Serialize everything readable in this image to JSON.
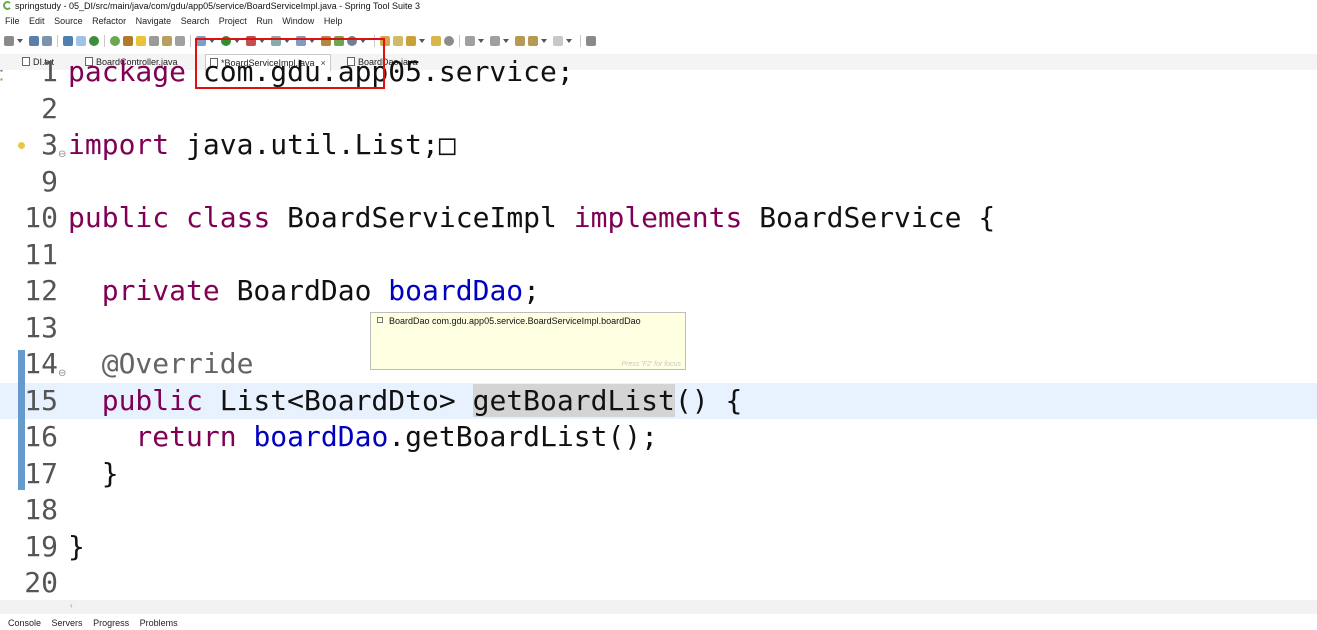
{
  "window": {
    "title": "springstudy - 05_DI/src/main/java/com/gdu/app05/service/BoardServiceImpl.java - Spring Tool Suite 3"
  },
  "menu": [
    "File",
    "Edit",
    "Source",
    "Refactor",
    "Navigate",
    "Search",
    "Project",
    "Run",
    "Window",
    "Help"
  ],
  "tabs": [
    {
      "label": "DI.txt"
    },
    {
      "label": "BoardController.java"
    },
    {
      "label": "*BoardServiceImpl.java",
      "close": "×"
    },
    {
      "label": "BoardDao.java"
    }
  ],
  "editor": {
    "lines": [
      {
        "num": "1",
        "parts": [
          {
            "t": "package ",
            "c": "kw"
          },
          {
            "t": "com.gdu.app05.service;"
          }
        ]
      },
      {
        "num": "2",
        "parts": []
      },
      {
        "num": "3",
        "parts": [
          {
            "t": "import ",
            "c": "kw"
          },
          {
            "t": "java.util.List;"
          },
          {
            "t": "□"
          }
        ]
      },
      {
        "num": "9",
        "parts": []
      },
      {
        "num": "10",
        "parts": [
          {
            "t": "public ",
            "c": "kw"
          },
          {
            "t": "class ",
            "c": "kw"
          },
          {
            "t": "BoardServiceImpl "
          },
          {
            "t": "implements ",
            "c": "kw"
          },
          {
            "t": "BoardService {"
          }
        ]
      },
      {
        "num": "11",
        "parts": []
      },
      {
        "num": "12",
        "parts": [
          {
            "t": "  private ",
            "c": "kw"
          },
          {
            "t": "BoardDao "
          },
          {
            "t": "boardDao",
            "c": "fld"
          },
          {
            "t": ";"
          }
        ]
      },
      {
        "num": "13",
        "parts": []
      },
      {
        "num": "14",
        "parts": [
          {
            "t": "  @Override",
            "c": "ann"
          }
        ]
      },
      {
        "num": "15",
        "parts": [
          {
            "t": "  public ",
            "c": "kw"
          },
          {
            "t": "List<BoardDto> "
          },
          {
            "t": "getBoardList",
            "c": "hl"
          },
          {
            "t": "() {"
          }
        ]
      },
      {
        "num": "16",
        "parts": [
          {
            "t": "    return ",
            "c": "kw"
          },
          {
            "t": "boardDao",
            "c": "fld"
          },
          {
            "t": ".getBoardList();"
          }
        ]
      },
      {
        "num": "17",
        "parts": [
          {
            "t": "  }"
          }
        ]
      },
      {
        "num": "18",
        "parts": []
      },
      {
        "num": "19",
        "parts": [
          {
            "t": "}"
          }
        ]
      },
      {
        "num": "20",
        "parts": []
      }
    ]
  },
  "tooltip": {
    "text": "BoardDao com.gdu.app05.service.BoardServiceImpl.boardDao",
    "footer": "Press 'F2' for focus"
  },
  "bottom_tabs": [
    "Console",
    "Servers",
    "Progress",
    "Problems"
  ]
}
